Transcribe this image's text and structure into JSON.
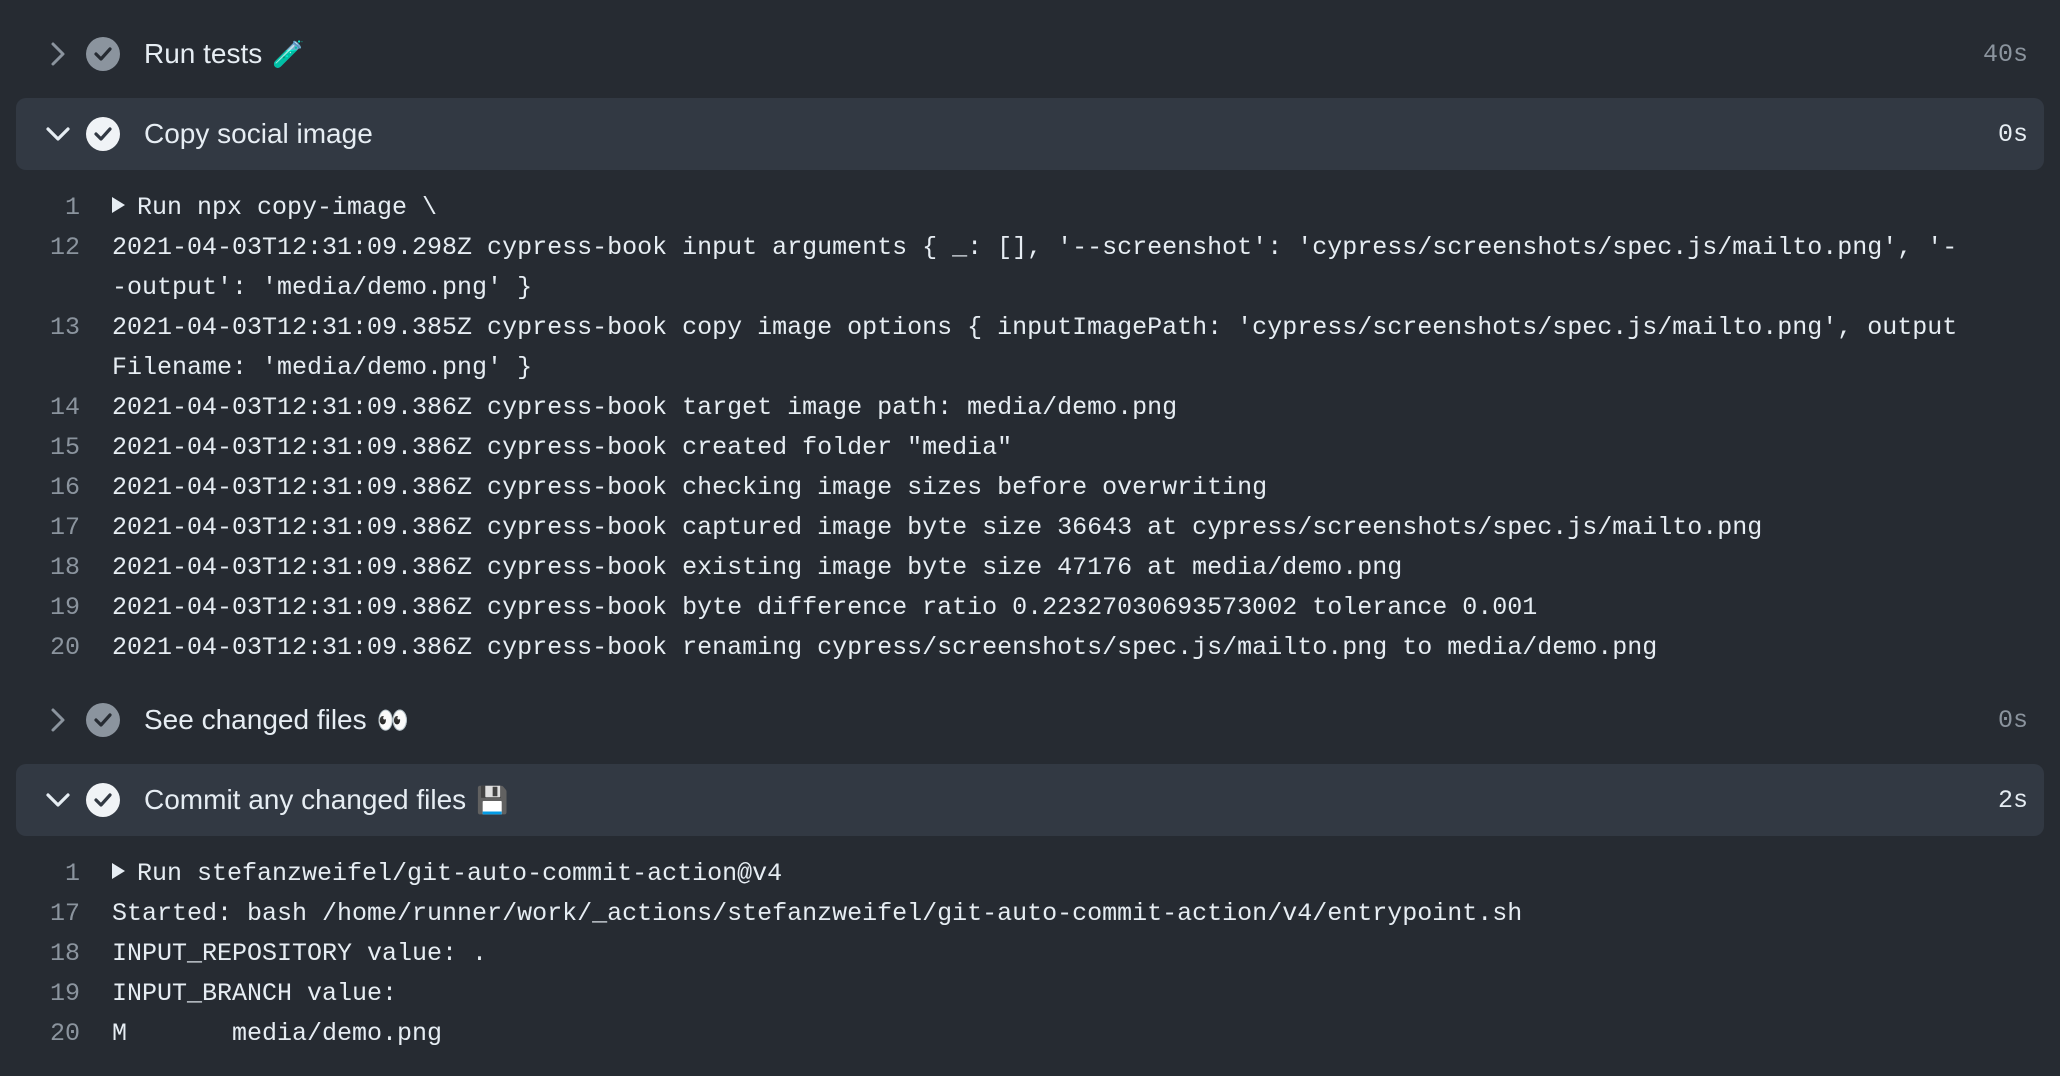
{
  "steps": [
    {
      "title": "Run tests",
      "emoji": "🧪",
      "duration": "40s",
      "expanded": false
    },
    {
      "title": "Copy social image",
      "emoji": "",
      "duration": "0s",
      "expanded": true,
      "lines": [
        {
          "num": "1",
          "text": "Run npx copy-image \\",
          "group": true
        },
        {
          "num": "12",
          "text": "2021-04-03T12:31:09.298Z cypress-book input arguments { _: [], '--screenshot': 'cypress/screenshots/spec.js/mailto.png', '--output': 'media/demo.png' }"
        },
        {
          "num": "13",
          "text": "2021-04-03T12:31:09.385Z cypress-book copy image options { inputImagePath: 'cypress/screenshots/spec.js/mailto.png', outputFilename: 'media/demo.png' }"
        },
        {
          "num": "14",
          "text": "2021-04-03T12:31:09.386Z cypress-book target image path: media/demo.png"
        },
        {
          "num": "15",
          "text": "2021-04-03T12:31:09.386Z cypress-book created folder \"media\""
        },
        {
          "num": "16",
          "text": "2021-04-03T12:31:09.386Z cypress-book checking image sizes before overwriting"
        },
        {
          "num": "17",
          "text": "2021-04-03T12:31:09.386Z cypress-book captured image byte size 36643 at cypress/screenshots/spec.js/mailto.png"
        },
        {
          "num": "18",
          "text": "2021-04-03T12:31:09.386Z cypress-book existing image byte size 47176 at media/demo.png"
        },
        {
          "num": "19",
          "text": "2021-04-03T12:31:09.386Z cypress-book byte difference ratio 0.22327030693573002 tolerance 0.001"
        },
        {
          "num": "20",
          "text": "2021-04-03T12:31:09.386Z cypress-book renaming cypress/screenshots/spec.js/mailto.png to media/demo.png"
        }
      ]
    },
    {
      "title": "See changed files",
      "emoji": "👀",
      "duration": "0s",
      "expanded": false
    },
    {
      "title": "Commit any changed files",
      "emoji": "💾",
      "duration": "2s",
      "expanded": true,
      "lines": [
        {
          "num": "1",
          "text": "Run stefanzweifel/git-auto-commit-action@v4",
          "group": true
        },
        {
          "num": "17",
          "text": "Started: bash /home/runner/work/_actions/stefanzweifel/git-auto-commit-action/v4/entrypoint.sh"
        },
        {
          "num": "18",
          "text": "INPUT_REPOSITORY value: ."
        },
        {
          "num": "19",
          "text": "INPUT_BRANCH value:"
        },
        {
          "num": "20",
          "text": "M       media/demo.png"
        }
      ]
    }
  ],
  "colors": {
    "background": "#262b32",
    "expanded_header": "#323943",
    "muted": "#8b949e",
    "text": "#e6edf3"
  },
  "icons": {
    "collapsed": "chevron-right-icon",
    "expanded": "chevron-down-icon",
    "status": "check-circle-icon"
  }
}
